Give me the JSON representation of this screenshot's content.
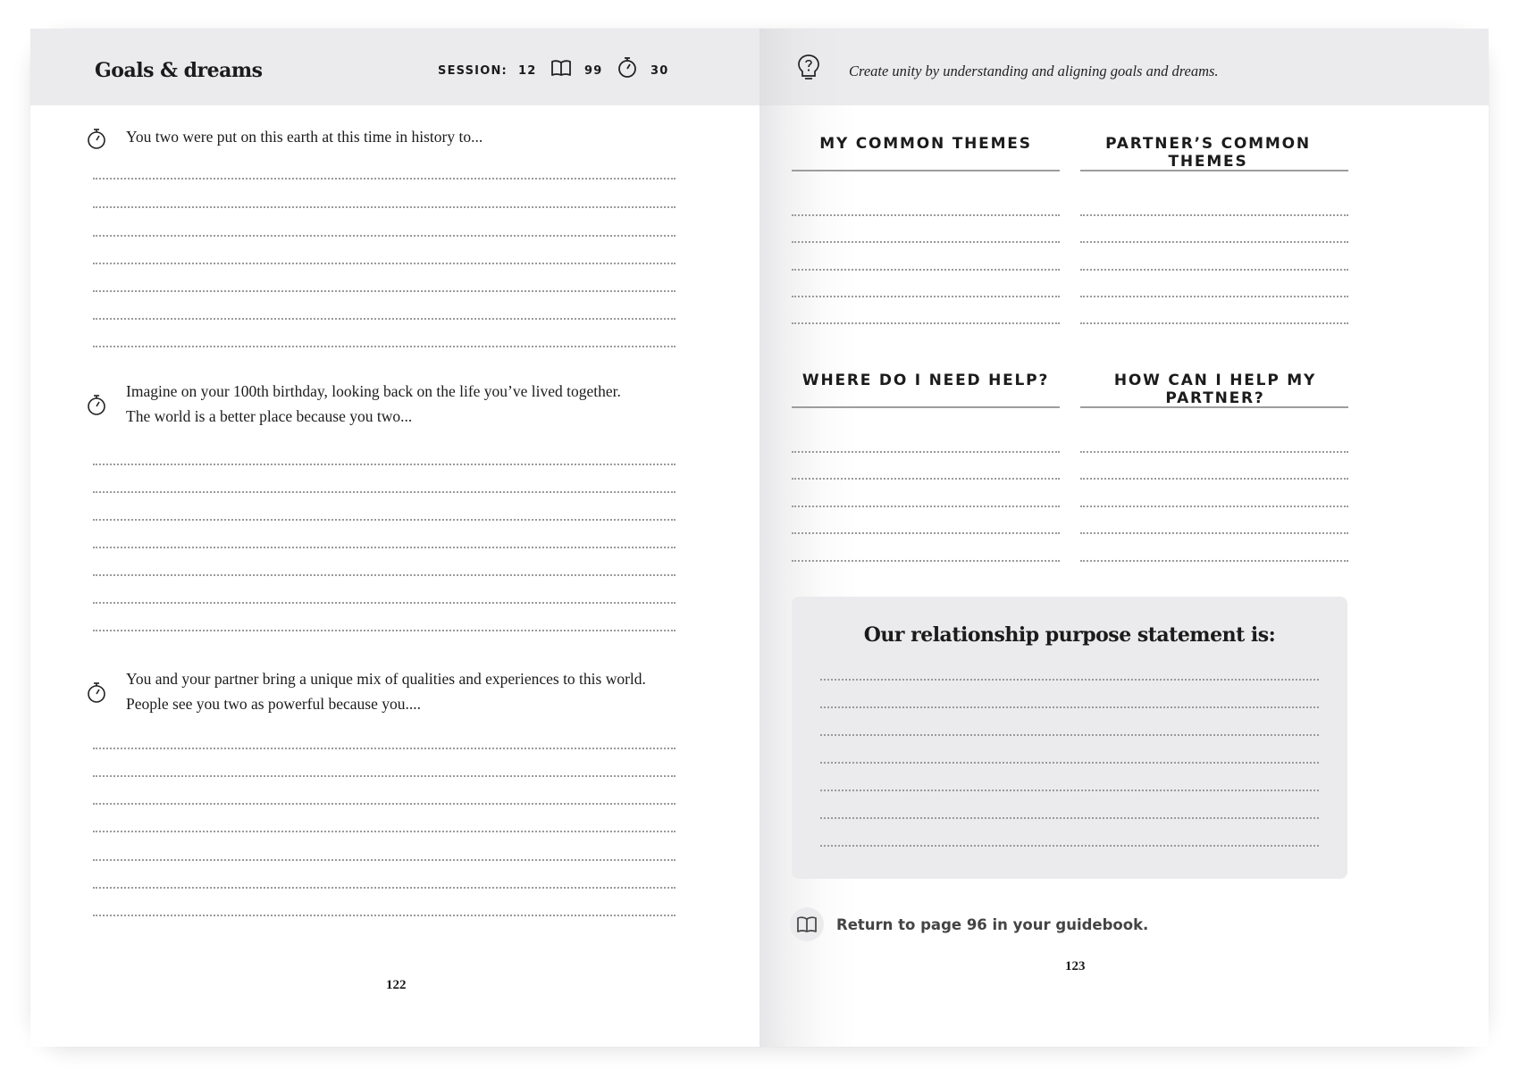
{
  "left_page": {
    "header": {
      "title": "Goals & dreams",
      "session_label": "SESSION:",
      "session_number": "12",
      "guidebook_page": "99",
      "minutes": "30"
    },
    "prompts": [
      {
        "text_lines": [
          "You two were put on this earth at this time in history to..."
        ],
        "icon": "stopwatch-icon"
      },
      {
        "text_lines": [
          "Imagine on your 100th birthday, looking back on the life you’ve lived together.",
          "The world is a better place because you two..."
        ],
        "icon": "stopwatch-icon"
      },
      {
        "text_lines": [
          "You and your partner bring a unique mix of qualities and experiences to this world.",
          "People see you two as powerful because you...."
        ],
        "icon": "stopwatch-icon"
      }
    ],
    "page_number": "122"
  },
  "right_page": {
    "header": {
      "tagline": "Create unity by understanding and aligning goals and dreams.",
      "icon": "lightbulb-question-icon"
    },
    "columns_top": [
      "MY COMMON THEMES",
      "PARTNER’S COMMON THEMES"
    ],
    "columns_bottom": [
      "WHERE DO I NEED HELP?",
      "HOW CAN I HELP MY PARTNER?"
    ],
    "purpose_box": {
      "title": "Our relationship purpose statement is:"
    },
    "return_note": {
      "text": "Return to page 96 in your guidebook.",
      "icon": "book-icon"
    },
    "page_number": "123"
  },
  "colors": {
    "header_band": "#ebebed",
    "panel": "#ebebed",
    "dot_rule": "#9a9a9a",
    "text": "#1b1b1b"
  }
}
